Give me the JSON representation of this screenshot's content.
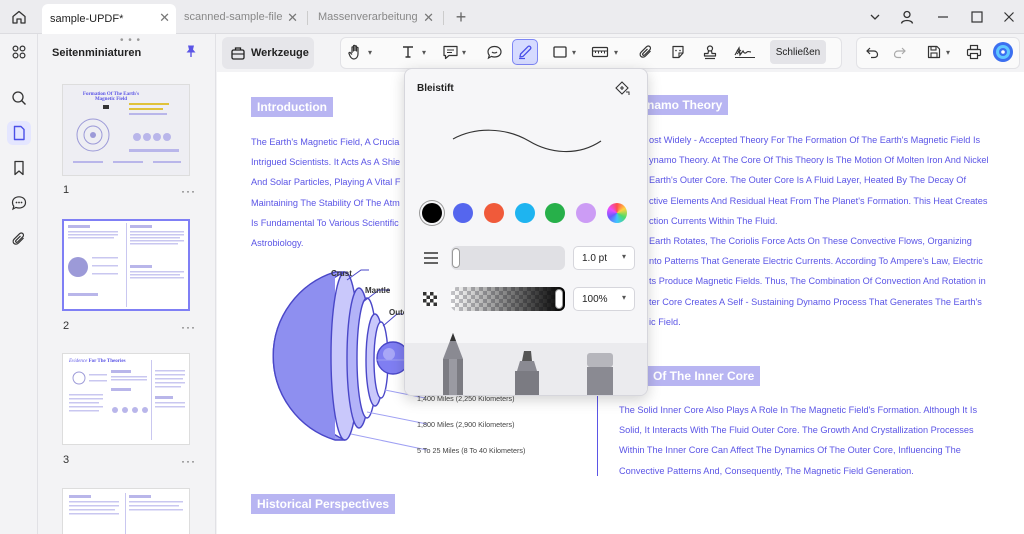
{
  "tabs": [
    {
      "label": "sample-UPDF*",
      "active": true
    },
    {
      "label": "scanned-sample-file",
      "active": false
    },
    {
      "label": "Massenverarbeitung",
      "active": false
    }
  ],
  "new_tab_symbol": "+",
  "close_symbol": "✕",
  "sidebar": {
    "title": "Seitenminiaturen",
    "pages": [
      {
        "number": "1",
        "more": "···"
      },
      {
        "number": "2",
        "more": "···"
      },
      {
        "number": "3",
        "more": "···"
      }
    ],
    "thumb1_title": "Formation Of The Earth's Magnetic Field",
    "thumb3_title_a": "Evidence",
    "thumb3_title_b": "For The Theories"
  },
  "toolbar": {
    "werkzeuge_label": "Werkzeuge",
    "close_label": "Schließen"
  },
  "popup": {
    "title": "Bleistift",
    "colors": [
      "#000000",
      "#5566ee",
      "#f05a3a",
      "#1eb4f0",
      "#27b04a",
      "#cc9cf5",
      "rainbow"
    ],
    "thickness_value": "1.0 pt",
    "opacity_value": "100%"
  },
  "document": {
    "introduction": {
      "heading": "Introduction",
      "lines": [
        "The Earth's Magnetic Field, A Crucia",
        "Intrigued Scientists. It Acts As A Shie",
        "And Solar Particles, Playing A Vital F",
        "Maintaining The Stability Of The Atm",
        "Is Fundamental To Various Scientific",
        "Astrobiology."
      ]
    },
    "dynamo": {
      "heading": "namo Theory",
      "lines": [
        "ost Widely - Accepted Theory For The Formation Of The Earth's Magnetic Field Is",
        "ynamo Theory. At The Core Of This Theory Is The Motion Of Molten Iron And Nickel",
        "Earth's Outer Core. The Outer Core Is A Fluid Layer, Heated By The Decay Of",
        "ctive Elements And Residual Heat From The Planet's Formation. This Heat Creates",
        "ction Currents Within The Fluid.",
        "Earth Rotates, The Coriolis Force Acts On These Convective Flows, Organizing",
        "nto Patterns That Generate Electric Currents. According To Ampere's Law, Electric",
        "ts Produce Magnetic Fields. Thus, The Combination Of Convection And Rotation in",
        "ter Core Creates A Self - Sustaining Dynamo Process That Generates The Earth's",
        "ic Field."
      ]
    },
    "inner_core": {
      "heading": "Of The Inner Core",
      "lines": [
        "The Solid Inner Core Also Plays A Role In The Magnetic Field's Formation. Although It Is",
        "Solid, It Interacts With The Fluid Outer Core. The Growth And Crystallization Processes",
        "Within The Inner Core Can Affect The Dynamics Of The Outer Core, Influencing The",
        "Convective Patterns And, Consequently, The Magnetic Field Generation."
      ]
    },
    "historical": {
      "heading": "Historical Perspectives"
    },
    "diagram": {
      "crust": "Crust",
      "mantle": "Mantle",
      "outer": "Oute",
      "dist1": "1,400 Miles (2,250 Kilometers)",
      "dist2": "1,800 Miles (2,900 Kilometers)",
      "dist3": "5 To 25 Miles (8 To 40 Kilometers)"
    }
  },
  "colors": {
    "accent": "#5b55e6",
    "heading_bg": "#b8b5f2",
    "active_blue": "#7d86f5"
  }
}
